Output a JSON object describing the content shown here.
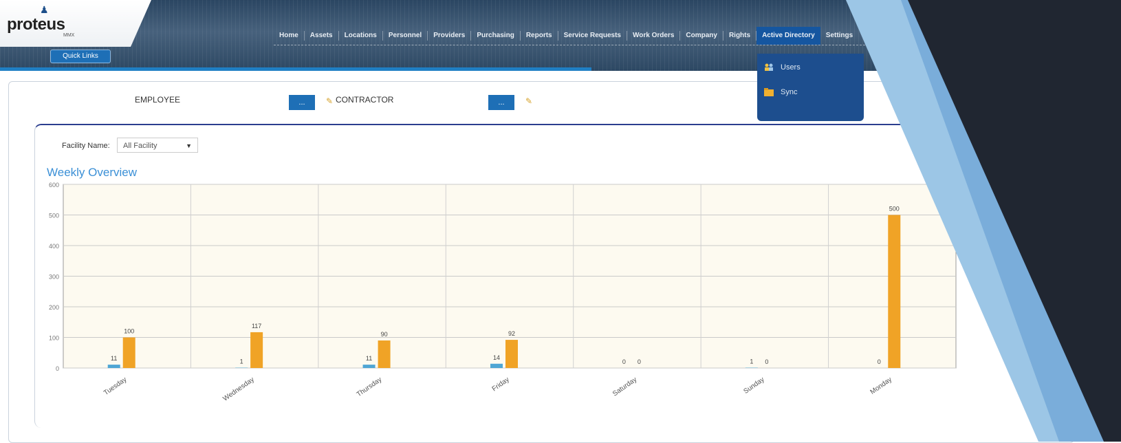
{
  "app": {
    "logo_text": "proteus",
    "logo_subtext": "MMX"
  },
  "quick_link": "Quick Links",
  "nav": {
    "items": [
      {
        "label": "Home"
      },
      {
        "label": "Assets"
      },
      {
        "label": "Locations"
      },
      {
        "label": "Personnel"
      },
      {
        "label": "Providers"
      },
      {
        "label": "Purchasing"
      },
      {
        "label": "Reports"
      },
      {
        "label": "Service Requests"
      },
      {
        "label": "Work Orders"
      },
      {
        "label": "Company"
      },
      {
        "label": "Rights"
      },
      {
        "label": "Active Directory"
      },
      {
        "label": "Settings"
      }
    ],
    "active_index": 11
  },
  "dropdown": {
    "items": [
      {
        "label": "Users"
      },
      {
        "label": "Sync"
      }
    ]
  },
  "filters": {
    "employee_label": "EMPLOYEE",
    "employee_button": "...",
    "contractor_label": "CONTRACTOR",
    "contractor_button": "..."
  },
  "facility": {
    "label": "Facility Name:",
    "selected": "All Facility"
  },
  "colors": {
    "series_employee": "#4fa6d4",
    "series_contractor": "#f0a326",
    "header_bg": "#3a556f",
    "accent": "#1e6fb6"
  },
  "chart_data": {
    "type": "bar",
    "title": "Weekly Overview",
    "categories": [
      "Tuesday",
      "Wednesday",
      "Thursday",
      "Friday",
      "Saturday",
      "Sunday",
      "Monday"
    ],
    "series": [
      {
        "values": [
          11,
          1,
          11,
          14,
          0,
          1,
          0
        ]
      },
      {
        "values": [
          100,
          117,
          90,
          92,
          0,
          0,
          500
        ]
      }
    ],
    "data_labels": [
      [
        "11",
        "1",
        "11",
        "14",
        "0",
        "1",
        "0"
      ],
      [
        "100",
        "117",
        "90",
        "92",
        "0",
        "0",
        "500"
      ]
    ],
    "ylim": [
      0,
      600
    ],
    "yticks": [
      0,
      100,
      200,
      300,
      400,
      500,
      600
    ],
    "grid": true
  }
}
